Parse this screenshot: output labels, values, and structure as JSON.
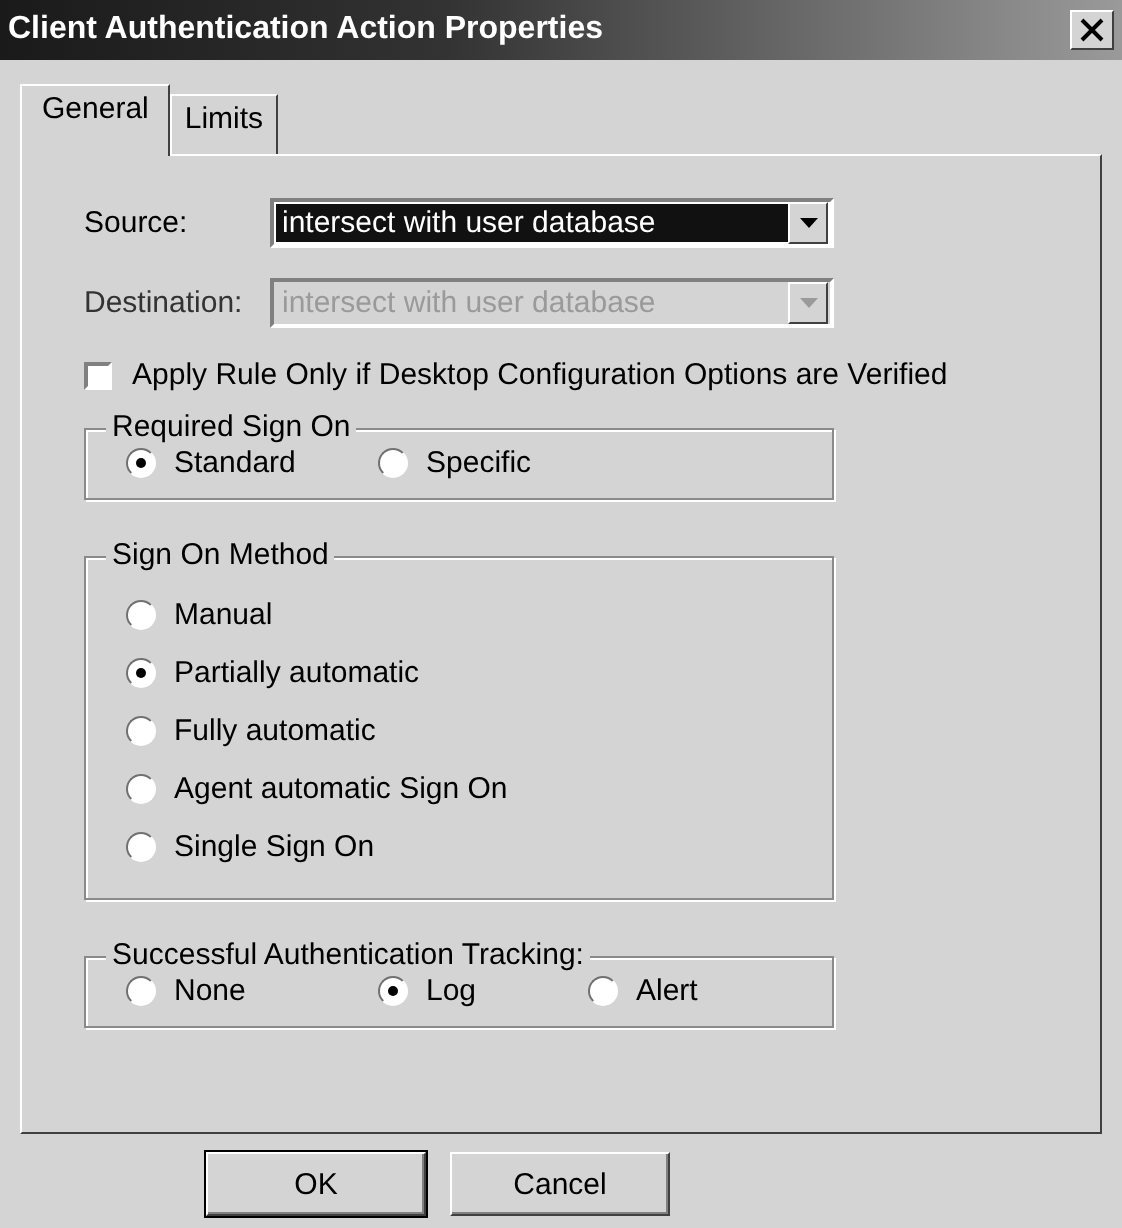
{
  "window": {
    "title": "Client Authentication Action Properties"
  },
  "tabs": [
    {
      "label": "General",
      "selected": true
    },
    {
      "label": "Limits",
      "selected": false
    }
  ],
  "fields": [
    {
      "label": "Source:",
      "value": "intersect with user database",
      "disabled": false,
      "highlighted": true
    },
    {
      "label": "Destination:",
      "value": "intersect with user database",
      "disabled": true,
      "highlighted": false
    }
  ],
  "checkbox": {
    "label": "Apply Rule Only if Desktop Configuration Options are Verified",
    "checked": false
  },
  "groups": [
    {
      "title": "Required Sign On",
      "kind": "row",
      "options": [
        {
          "label": "Standard",
          "selected": true
        },
        {
          "label": "Specific",
          "selected": false
        }
      ]
    },
    {
      "title": "Sign On Method",
      "kind": "column",
      "options": [
        {
          "label": "Manual",
          "selected": false
        },
        {
          "label": "Partially automatic",
          "selected": true
        },
        {
          "label": "Fully automatic",
          "selected": false
        },
        {
          "label": "Agent automatic Sign On",
          "selected": false
        },
        {
          "label": "Single Sign On",
          "selected": false
        }
      ]
    },
    {
      "title": "Successful Authentication Tracking:",
      "kind": "row",
      "options": [
        {
          "label": "None",
          "selected": false
        },
        {
          "label": "Log",
          "selected": true
        },
        {
          "label": "Alert",
          "selected": false
        }
      ]
    }
  ],
  "buttons": [
    {
      "label": "OK",
      "default": true
    },
    {
      "label": "Cancel",
      "default": false
    }
  ]
}
